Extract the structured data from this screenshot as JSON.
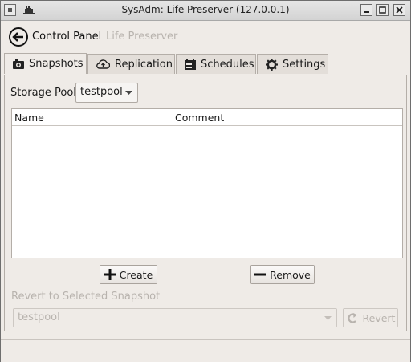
{
  "window": {
    "title": "SysAdm: Life Preserver (127.0.0.1)"
  },
  "nav": {
    "back_icon": "back-arrow-icon",
    "breadcrumb_root": "Control Panel",
    "breadcrumb_current": "Life Preserver"
  },
  "tabs": [
    {
      "label": "Snapshots",
      "icon": "camera-icon",
      "active": true
    },
    {
      "label": "Replication",
      "icon": "cloud-upload-icon",
      "active": false
    },
    {
      "label": "Schedules",
      "icon": "calendar-icon",
      "active": false
    },
    {
      "label": "Settings",
      "icon": "gear-icon",
      "active": false
    }
  ],
  "snapshots": {
    "pool_label": "Storage Pool",
    "pool_value": "testpool",
    "table": {
      "columns": [
        "Name",
        "Comment"
      ],
      "rows": []
    },
    "create_label": "Create",
    "remove_label": "Remove",
    "revert_section_label": "Revert to Selected Snapshot",
    "revert_combo_value": "testpool",
    "revert_label": "Revert"
  },
  "colors": {
    "window_bg": "#efebe7",
    "disabled_text": "#b8b3ae",
    "border": "#b4aea8"
  }
}
